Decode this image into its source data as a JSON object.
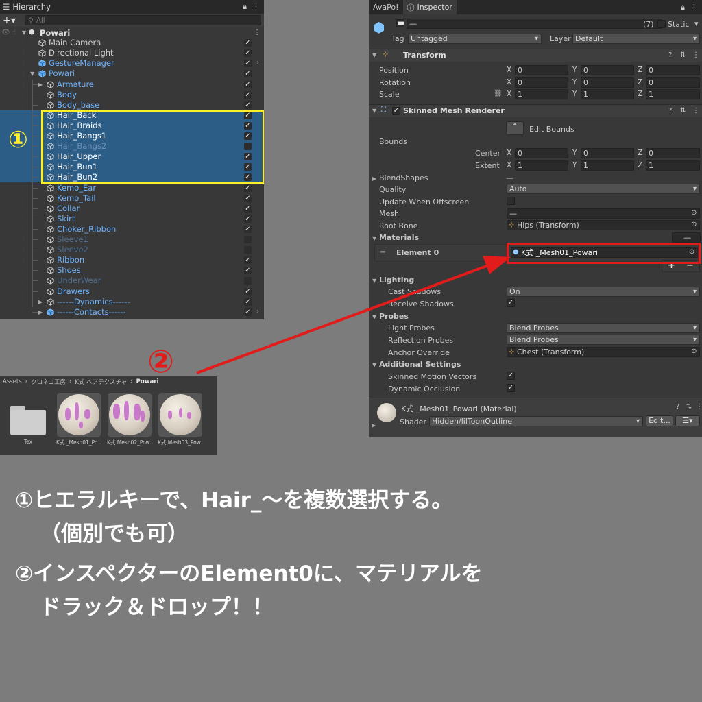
{
  "hierarchy": {
    "tab_title": "Hierarchy",
    "search_placeholder": "All",
    "scene_name": "Powari",
    "items": [
      {
        "label": "Main Camera",
        "color": "#d2d2d2",
        "checked": true
      },
      {
        "label": "Directional Light",
        "color": "#d2d2d2",
        "checked": true
      },
      {
        "label": "GestureManager",
        "color": "#6fb4ff",
        "checked": true,
        "arrow": true
      },
      {
        "label": "Powari",
        "color": "#6fb4ff",
        "checked": true
      },
      {
        "label": "Armature",
        "color": "#6fb4ff",
        "checked": true
      },
      {
        "label": "Body",
        "color": "#6fb4ff",
        "checked": true
      },
      {
        "label": "Body_base",
        "color": "#6fb4ff",
        "checked": true
      },
      {
        "label": "Hair_Back",
        "color": "#ffffff",
        "checked": true,
        "selected": true
      },
      {
        "label": "Hair_Braids",
        "color": "#ffffff",
        "checked": true,
        "selected": true
      },
      {
        "label": "Hair_Bangs1",
        "color": "#ffffff",
        "checked": true,
        "selected": true
      },
      {
        "label": "Hair_Bangs2",
        "color": "#6d8fb4",
        "checked": false,
        "selected": true
      },
      {
        "label": "Hair_Upper",
        "color": "#ffffff",
        "checked": true,
        "selected": true
      },
      {
        "label": "Hair_Bun1",
        "color": "#ffffff",
        "checked": true,
        "selected": true
      },
      {
        "label": "Hair_Bun2",
        "color": "#ffffff",
        "checked": true,
        "selected": true
      },
      {
        "label": "Kemo_Ear",
        "color": "#6fb4ff",
        "checked": true
      },
      {
        "label": "Kemo_Tail",
        "color": "#6fb4ff",
        "checked": true
      },
      {
        "label": "Collar",
        "color": "#6fb4ff",
        "checked": true
      },
      {
        "label": "Skirt",
        "color": "#6fb4ff",
        "checked": true
      },
      {
        "label": "Choker_Ribbon",
        "color": "#6fb4ff",
        "checked": true
      },
      {
        "label": "Sleeve1",
        "color": "#4f6e90",
        "checked": false
      },
      {
        "label": "Sleeve2",
        "color": "#4f6e90",
        "checked": false
      },
      {
        "label": "Ribbon",
        "color": "#6fb4ff",
        "checked": true
      },
      {
        "label": "Shoes",
        "color": "#6fb4ff",
        "checked": true
      },
      {
        "label": "UnderWear",
        "color": "#4f6e90",
        "checked": false
      },
      {
        "label": "Drawers",
        "color": "#6fb4ff",
        "checked": true
      },
      {
        "label": "------Dynamics------",
        "color": "#6fb4ff",
        "checked": true
      },
      {
        "label": "------Contacts------",
        "color": "#6fb4ff",
        "checked": true,
        "arrow": true
      }
    ],
    "callout": "①"
  },
  "project": {
    "breadcrumb": [
      "Assets",
      "クロネコ工房",
      "K式 ヘアテクスチャ",
      "Powari"
    ],
    "assets": [
      {
        "name": "Tex",
        "type": "folder"
      },
      {
        "name": "K式 _Mesh01_Po...",
        "type": "material"
      },
      {
        "name": "K式 Mesh02_Pow...",
        "type": "material"
      },
      {
        "name": "K式 Mesh03_Pow...",
        "type": "material"
      }
    ]
  },
  "inspector": {
    "tabs": [
      "AvaPo!",
      "Inspector"
    ],
    "object_name": "—",
    "multi_count": "(7)",
    "static_label": "Static",
    "tag_label": "Tag",
    "tag_value": "Untagged",
    "layer_label": "Layer",
    "layer_value": "Default",
    "transform": {
      "title": "Transform",
      "rows": [
        {
          "label": "Position",
          "x": "0",
          "y": "0",
          "z": "0"
        },
        {
          "label": "Rotation",
          "x": "0",
          "y": "0",
          "z": "0"
        },
        {
          "label": "Scale",
          "x": "1",
          "y": "1",
          "z": "1"
        }
      ]
    },
    "smr": {
      "title": "Skinned Mesh Renderer",
      "edit_bounds": "Edit Bounds",
      "bounds_label": "Bounds",
      "center_label": "Center",
      "center": {
        "x": "0",
        "y": "0",
        "z": "0"
      },
      "extent_label": "Extent",
      "extent": {
        "x": "1",
        "y": "1",
        "z": "1"
      },
      "blendshapes_label": "BlendShapes",
      "blendshapes_value": "—",
      "quality_label": "Quality",
      "quality_value": "Auto",
      "update_offscreen_label": "Update When Offscreen",
      "mesh_label": "Mesh",
      "mesh_value": "—",
      "root_bone_label": "Root Bone",
      "root_bone_value": "Hips (Transform)",
      "materials_label": "Materials",
      "materials_count": "—",
      "element0_label": "Element 0",
      "element0_value": "K式 _Mesh01_Powari",
      "lighting_label": "Lighting",
      "cast_shadows_label": "Cast Shadows",
      "cast_shadows_value": "On",
      "receive_shadows_label": "Receive Shadows",
      "probes_label": "Probes",
      "light_probes_label": "Light Probes",
      "light_probes_value": "Blend Probes",
      "reflection_probes_label": "Reflection Probes",
      "reflection_probes_value": "Blend Probes",
      "anchor_override_label": "Anchor Override",
      "anchor_override_value": "Chest (Transform)",
      "additional_label": "Additional Settings",
      "skinned_motion_label": "Skinned Motion Vectors",
      "dynamic_occlusion_label": "Dynamic Occlusion"
    },
    "material": {
      "title": "K式 _Mesh01_Powari (Material)",
      "shader_label": "Shader",
      "shader_value": "Hidden/lilToonOutline",
      "edit_button": "Edit..."
    }
  },
  "annotation": {
    "callout2": "②",
    "line1": "①ヒエラルキーで、Hair_～を複数選択する。",
    "line2": "（個別でも可）",
    "line3": "②インスペクターのElement0に、マテリアルを",
    "line4": "ドラック＆ドロップ！！",
    "colors": {
      "highlight_yellow": "#ffef2a",
      "highlight_red": "#e21b1b"
    }
  }
}
